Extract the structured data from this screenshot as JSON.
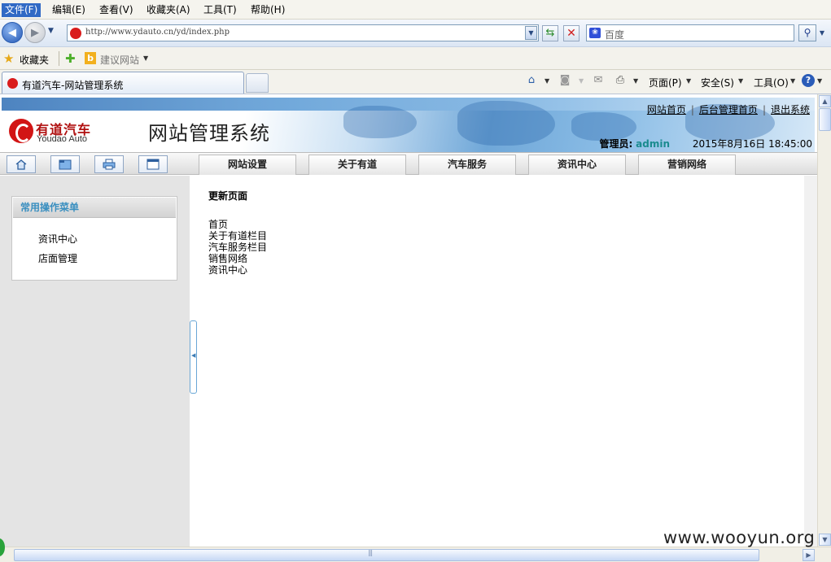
{
  "browser": {
    "menu": [
      "文件(F)",
      "编辑(E)",
      "查看(V)",
      "收藏夹(A)",
      "工具(T)",
      "帮助(H)"
    ],
    "address": "http://www.ydauto.cn/yd/index.php",
    "search_placeholder": "百度",
    "favorites_label": "收藏夹",
    "suggested_sites_label": "建议网站",
    "tab_title": "有道汽车-网站管理系统",
    "command_bar": {
      "page_label": "页面(P)",
      "safety_label": "安全(S)",
      "tools_label": "工具(O)"
    }
  },
  "site": {
    "logo_cn": "有道汽车",
    "logo_en": "Youdao Auto",
    "title": "网站管理系统",
    "top_links": [
      "网站首页",
      "后台管理首页",
      "退出系统"
    ],
    "admin_label": "管理员:",
    "admin_name": "admin",
    "datetime": "2015年8月16日  18:45:00",
    "quick_icons": [
      "home-icon",
      "folder-icon",
      "printer-icon",
      "window-icon"
    ],
    "nav_tabs": [
      "网站设置",
      "关于有道",
      "汽车服务",
      "资讯中心",
      "营销网络"
    ]
  },
  "sidebar": {
    "title": "常用操作菜单",
    "items": [
      "资讯中心",
      "店面管理"
    ]
  },
  "main": {
    "heading": "更新页面",
    "links": [
      "首页",
      "关于有道栏目",
      "汽车服务栏目",
      "销售网络",
      "资讯中心"
    ]
  },
  "watermark": "www.wooyun.org"
}
